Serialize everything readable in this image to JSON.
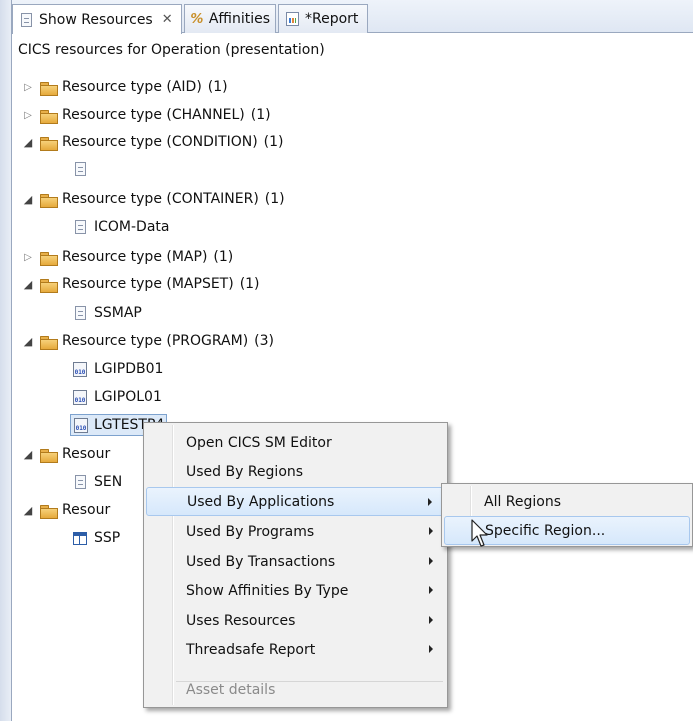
{
  "tabs": [
    {
      "label": "Show Resources",
      "icon": "document-icon",
      "closable": true,
      "active": true
    },
    {
      "label": "Affinities",
      "icon": "affinities-icon",
      "active": false
    },
    {
      "label": "*Report",
      "icon": "report-icon",
      "active": false
    }
  ],
  "header": {
    "title": "CICS resources for Operation (presentation)"
  },
  "tree": {
    "aid": {
      "label": "Resource type (AID)",
      "count": "(1)"
    },
    "channel": {
      "label": "Resource type (CHANNEL)",
      "count": "(1)"
    },
    "condition": {
      "label": "Resource type (CONDITION)",
      "count": "(1)"
    },
    "container": {
      "label": "Resource type (CONTAINER)",
      "count": "(1)",
      "child": "ICOM-Data"
    },
    "map": {
      "label": "Resource type (MAP)",
      "count": "(1)"
    },
    "mapset": {
      "label": "Resource type (MAPSET)",
      "count": "(1)",
      "child": "SSMAP"
    },
    "program": {
      "label": "Resource type (PROGRAM)",
      "count": "(3)",
      "children": [
        "LGIPDB01",
        "LGIPOL01",
        "LGTESTP4"
      ]
    },
    "partial1": {
      "label": "Resour",
      "child": "SEN"
    },
    "partial2": {
      "label": "Resour",
      "child": "SSP"
    }
  },
  "context_menu": {
    "items": [
      {
        "label": "Open CICS SM Editor",
        "submenu": false
      },
      {
        "label": "Used By Regions",
        "submenu": false
      },
      {
        "label": "Used By Applications",
        "submenu": true
      },
      {
        "label": "Used By Programs",
        "submenu": true
      },
      {
        "label": "Used By Transactions",
        "submenu": true
      },
      {
        "label": "Show Affinities By Type",
        "submenu": true
      },
      {
        "label": "Uses Resources",
        "submenu": true
      },
      {
        "label": "Threadsafe Report",
        "submenu": true
      },
      {
        "label": "Asset details",
        "submenu": false,
        "disabled": true
      }
    ],
    "highlighted": "Used By Applications"
  },
  "submenu": {
    "items": [
      {
        "label": "All Regions"
      },
      {
        "label": "Specific Region..."
      }
    ],
    "highlighted": "Specific Region..."
  },
  "colors": {
    "selection": "#dce9f8",
    "menu_highlight": "#d6e8fb",
    "folder": "#e8b04a"
  }
}
